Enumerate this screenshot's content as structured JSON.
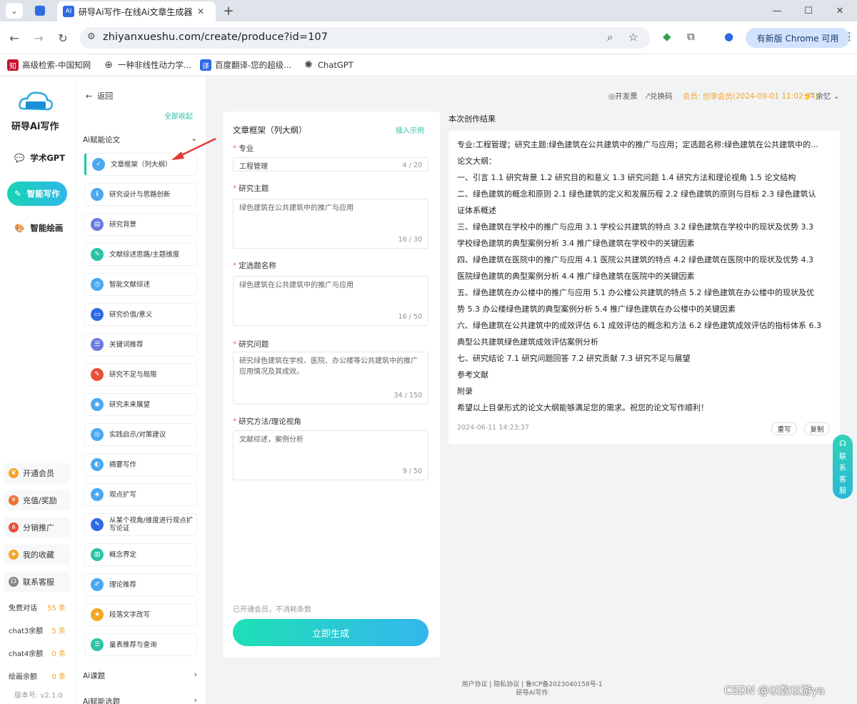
{
  "browser": {
    "tab_title": "研导Ai写作-在线Ai文章生成器",
    "url": "zhiyanxueshu.com/create/produce?id=107",
    "update_label": "有新版 Chrome 可用",
    "bookmarks": [
      {
        "label": "高级检索-中国知网"
      },
      {
        "label": "一种非线性动力学..."
      },
      {
        "label": "百度翻译-您的超级..."
      },
      {
        "label": "ChatGPT"
      }
    ]
  },
  "sidebar": {
    "brand": "研导Ai写作",
    "nav": [
      {
        "label": "学术GPT"
      },
      {
        "label": "智能写作"
      },
      {
        "label": "智能绘画"
      }
    ],
    "buttons": [
      {
        "label": "开通会员"
      },
      {
        "label": "充值/奖励"
      },
      {
        "label": "分销推广"
      },
      {
        "label": "我的收藏"
      },
      {
        "label": "联系客服"
      }
    ],
    "quotas": [
      {
        "label": "免费对话",
        "value": "55 条"
      },
      {
        "label": "chat3余额",
        "value": "5 条"
      },
      {
        "label": "chat4余额",
        "value": "0 条"
      },
      {
        "label": "绘画余额",
        "value": "0 条"
      }
    ],
    "version": "版本号: v2.1.0"
  },
  "menu": {
    "back_label": "返回",
    "collapse_label": "全部收起",
    "group_title": "Ai赋能论文",
    "items": [
      {
        "label": "文章框架（列大纲）"
      },
      {
        "label": "研究设计与思路创新"
      },
      {
        "label": "研究背景"
      },
      {
        "label": "文献综述思路/主题维度"
      },
      {
        "label": "智能文献综述"
      },
      {
        "label": "研究价值/意义"
      },
      {
        "label": "关键词推荐"
      },
      {
        "label": "研究不足与局限"
      },
      {
        "label": "研究未来展望"
      },
      {
        "label": "实践启示/对策建议"
      },
      {
        "label": "摘要写作"
      },
      {
        "label": "观点扩写"
      },
      {
        "label": "从某个视角/维度进行观点扩写论证"
      },
      {
        "label": "概念界定"
      },
      {
        "label": "理论推荐"
      },
      {
        "label": "段落文字改写"
      },
      {
        "label": "量表推荐与查询"
      }
    ],
    "group2": "Ai课题",
    "group3": "Ai赋能选题"
  },
  "topbar": {
    "invoice": "开发票",
    "redeem": "兑换码",
    "member_label": "会员:",
    "member_value": "创享会员(2024-09-01 11:02:34)",
    "user": "余忆"
  },
  "form": {
    "title": "文章框架（列大纲）",
    "example_link": "插入示例",
    "fields": [
      {
        "label": "专业",
        "value": "工程管理",
        "count": "4 / 20"
      },
      {
        "label": "研究主题",
        "value": "绿色建筑在公共建筑中的推广与应用",
        "count": "16 / 30"
      },
      {
        "label": "定选题名称",
        "value": "绿色建筑在公共建筑中的推广与应用",
        "count": "16 / 50"
      },
      {
        "label": "研究问题",
        "value": "研究绿色建筑在学校、医院、办公楼等公共建筑中的推广应用情况及其成效。",
        "count": "34 / 150"
      },
      {
        "label": "研究方法/理论视角",
        "value": "文献综述，案例分析",
        "count": "9 / 50"
      }
    ],
    "note": "已开通会员，不消耗条数",
    "generate_label": "立即生成"
  },
  "result": {
    "title": "本次创作结果",
    "lines": [
      "专业:工程管理；研究主题:绿色建筑在公共建筑中的推广与应用；定选题名称:绿色建筑在公共建筑中的...",
      "论文大纲：",
      "一、引言 1.1 研究背景 1.2 研究目的和意义 1.3 研究问题 1.4 研究方法和理论视角 1.5 论文结构",
      "二、绿色建筑的概念和原则 2.1 绿色建筑的定义和发展历程 2.2 绿色建筑的原则与目标 2.3 绿色建筑认",
      "证体系概述",
      "三、绿色建筑在学校中的推广与应用 3.1 学校公共建筑的特点 3.2 绿色建筑在学校中的现状及优势 3.3",
      "学校绿色建筑的典型案例分析 3.4 推广绿色建筑在学校中的关键因素",
      "四、绿色建筑在医院中的推广与应用 4.1 医院公共建筑的特点 4.2 绿色建筑在医院中的现状及优势 4.3",
      "医院绿色建筑的典型案例分析 4.4 推广绿色建筑在医院中的关键因素",
      "五、绿色建筑在办公楼中的推广与应用 5.1 办公楼公共建筑的特点 5.2 绿色建筑在办公楼中的现状及优",
      "势 5.3 办公楼绿色建筑的典型案例分析 5.4 推广绿色建筑在办公楼中的关键因素",
      "六、绿色建筑在公共建筑中的成效评估 6.1 成效评估的概念和方法 6.2 绿色建筑成效评估的指标体系 6.3",
      "典型公共建筑绿色建筑成效评估案例分析",
      "七、研究结论 7.1 研究问题回答 7.2 研究贡献 7.3 研究不足与展望",
      "参考文献",
      "附录",
      "希望以上目录形式的论文大纲能够满足您的需求。祝您的论文写作顺利！"
    ],
    "date": "2024-06-11 14:23:37",
    "rewrite_label": "重写",
    "copy_label": "复制"
  },
  "service_label": [
    "联",
    "系",
    "客",
    "服"
  ],
  "footer": {
    "line1": "用户协议 | 隐私协议 | 鲁ICP备2023040158号-1",
    "line2": "研导AI写作"
  },
  "watermark": "CSDN @以数以游ya",
  "colors": {
    "accent": "#1ec8a5",
    "accent2": "#34b6ee",
    "required": "#f56c6c",
    "quota": "#f5a623"
  }
}
